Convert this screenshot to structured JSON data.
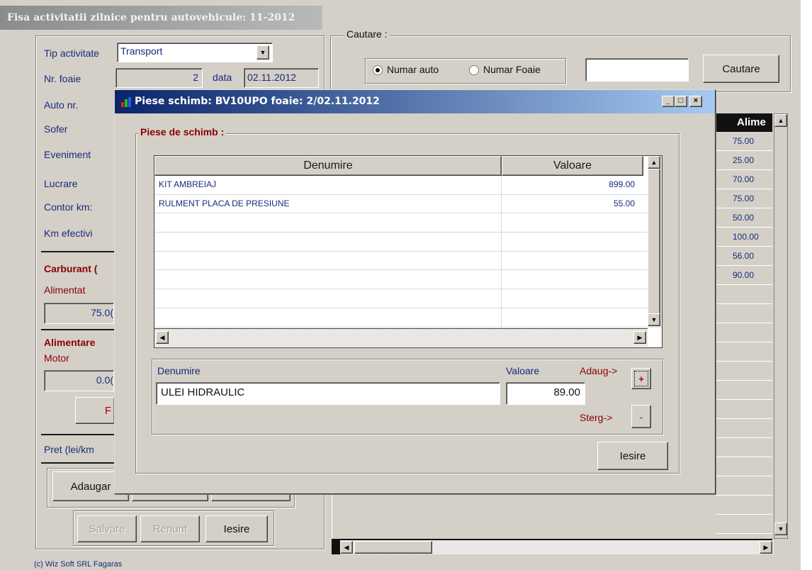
{
  "main": {
    "title": "Fisa activitatii zilnice pentru autovehicule: 11-2012",
    "tip_activitate_label": "Tip activitate",
    "tip_activitate_value": "Transport",
    "nr_foaie_label": "Nr. foaie",
    "nr_foaie_value": "2",
    "data_label": "data",
    "data_value": "02.11.2012",
    "auto_nr_label": "Auto nr.",
    "sofer_label": "Sofer",
    "eveniment_label": "Eveniment",
    "lucrare_label": "Lucrare",
    "contor_label": "Contor km:",
    "km_efectivi_label": "Km efectivi",
    "carburant_label": "Carburant (",
    "alimentat_label": "Alimentat",
    "alimentat_value": "75.0(",
    "alimentare_label": "Alimentare",
    "motor_label": "Motor",
    "motor_value": "0.0(",
    "f_button": "F",
    "pret_label": "Pret (lei/km",
    "adaugare_button": "Adaugar",
    "salvare_button": "Salvare",
    "renunt_button": "Renunt",
    "iesire_button": "Iesire",
    "footer": "(c) Wiz Soft SRL Fagaras"
  },
  "search": {
    "group_label": "Cautare :",
    "radio_auto": "Numar auto",
    "radio_foaie": "Numar Foaie",
    "input_value": "",
    "button": "Cautare"
  },
  "grid": {
    "header": "Alime",
    "values": [
      "75.00",
      "25.00",
      "70.00",
      "75.00",
      "50.00",
      "100.00",
      "56.00",
      "90.00"
    ]
  },
  "dialog": {
    "title": "Piese schimb: BV10UPO    foaie: 2/02.11.2012",
    "group_label": "Piese de schimb :",
    "col_denumire": "Denumire",
    "col_valoare": "Valoare",
    "rows": [
      {
        "denumire": "KIT AMBREIAJ",
        "valoare": "899.00"
      },
      {
        "denumire": "RULMENT PLACA DE PRESIUNE",
        "valoare": "55.00"
      }
    ],
    "form_denumire_label": "Denumire",
    "form_valoare_label": "Valoare",
    "denumire_input": "ULEI HIDRAULIC",
    "valoare_input": "89.00",
    "adaug_label": "Adaug->",
    "adaug_button": "+",
    "sterg_label": "Sterg->",
    "sterg_button": "-",
    "iesire_button": "Iesire",
    "minimize": "_",
    "maximize": "□",
    "close": "×"
  }
}
